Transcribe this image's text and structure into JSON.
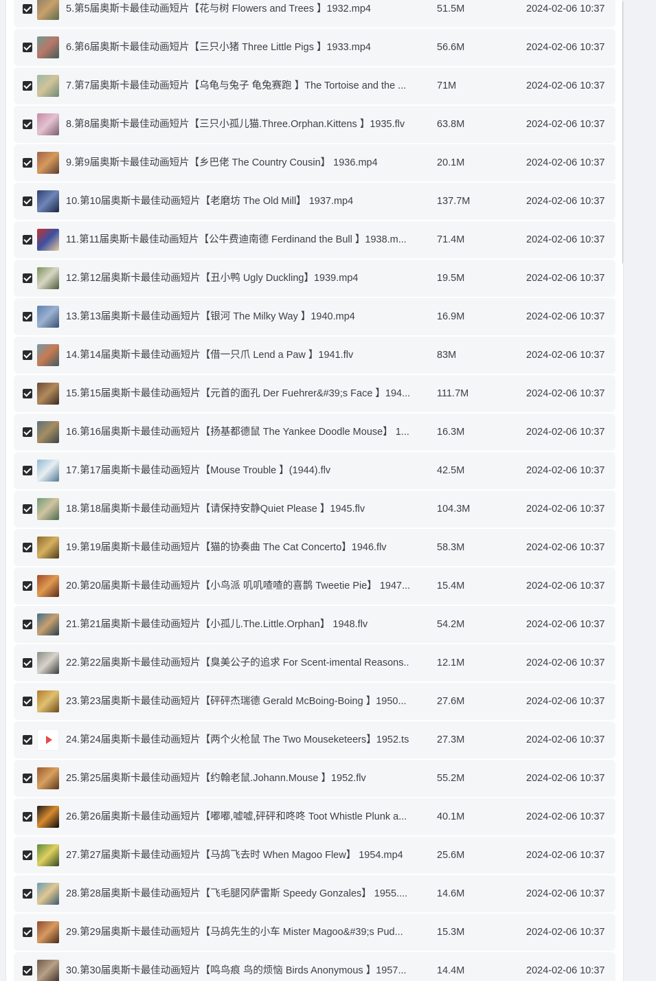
{
  "files": [
    {
      "name": "5.第5届奥斯卡最佳动画短片【花与树 Flowers and Trees 】1932.mp4",
      "size": "51.5M",
      "date": "2024-02-06 10:37",
      "thumb": [
        "#8a7e6b",
        "#c9a06a",
        "#5a6b4e"
      ]
    },
    {
      "name": "6.第6届奥斯卡最佳动画短片【三只小猪 Three Little Pigs 】1933.mp4",
      "size": "56.6M",
      "date": "2024-02-06 10:37",
      "thumb": [
        "#6f9a8c",
        "#b8776a",
        "#3e5f52"
      ]
    },
    {
      "name": "7.第7届奥斯卡最佳动画短片【乌龟与兔子 龟兔赛跑 】The Tortoise and the ...",
      "size": "71M",
      "date": "2024-02-06 10:37",
      "thumb": [
        "#9bb7a3",
        "#d2c49a",
        "#6b8a74"
      ]
    },
    {
      "name": "8.第8届奥斯卡最佳动画短片【三只小孤儿猫.Three.Orphan.Kittens 】1935.flv",
      "size": "63.8M",
      "date": "2024-02-06 10:37",
      "thumb": [
        "#c58aa4",
        "#e4c3d0",
        "#7a5c6e"
      ]
    },
    {
      "name": "9.第9届奥斯卡最佳动画短片【乡巴佬 The Country Cousin】 1936.mp4",
      "size": "20.1M",
      "date": "2024-02-06 10:37",
      "thumb": [
        "#a0604a",
        "#d69a5c",
        "#5a3c30"
      ]
    },
    {
      "name": "10.第10届奥斯卡最佳动画短片【老磨坊 The Old Mill】 1937.mp4",
      "size": "137.7M",
      "date": "2024-02-06 10:37",
      "thumb": [
        "#2e3f6e",
        "#6f86b8",
        "#1a2340"
      ]
    },
    {
      "name": "11.第11届奥斯卡最佳动画短片【公牛费迪南德 Ferdinand the Bull 】1938.m...",
      "size": "71.4M",
      "date": "2024-02-06 10:37",
      "thumb": [
        "#c8322e",
        "#3b4fa0",
        "#e7c9a0"
      ]
    },
    {
      "name": "12.第12届奥斯卡最佳动画短片【丑小鸭 Ugly Duckling】1939.mp4",
      "size": "19.5M",
      "date": "2024-02-06 10:37",
      "thumb": [
        "#7c8f5a",
        "#d8d6c4",
        "#4b5a38"
      ]
    },
    {
      "name": "13.第13届奥斯卡最佳动画短片【银河 The Milky Way 】1940.mp4",
      "size": "16.9M",
      "date": "2024-02-06 10:37",
      "thumb": [
        "#5e7fb0",
        "#9bb2d0",
        "#3a4e70"
      ]
    },
    {
      "name": "14.第14届奥斯卡最佳动画短片【借一只爪 Lend a Paw 】1941.flv",
      "size": "83M",
      "date": "2024-02-06 10:37",
      "thumb": [
        "#6f9aa8",
        "#c87a52",
        "#3e5a60"
      ]
    },
    {
      "name": "15.第15届奥斯卡最佳动画短片【元首的面孔 Der Fuehrer&#39;s Face 】194...",
      "size": "111.7M",
      "date": "2024-02-06 10:37",
      "thumb": [
        "#6b4a34",
        "#b28a5c",
        "#3a2a20"
      ]
    },
    {
      "name": "16.第16届奥斯卡最佳动画短片【扬基都德鼠 The Yankee Doodle Mouse】 1...",
      "size": "16.3M",
      "date": "2024-02-06 10:37",
      "thumb": [
        "#5d6e7a",
        "#a58e62",
        "#39434a"
      ]
    },
    {
      "name": "17.第17届奥斯卡最佳动画短片【Mouse Trouble 】(1944).flv",
      "size": "42.5M",
      "date": "2024-02-06 10:37",
      "thumb": [
        "#8fb8d0",
        "#e8eef2",
        "#4f7890"
      ]
    },
    {
      "name": "18.第18届奥斯卡最佳动画短片【请保持安静Quiet Please 】1945.flv",
      "size": "104.3M",
      "date": "2024-02-06 10:37",
      "thumb": [
        "#6f9a78",
        "#d0c4a0",
        "#4a6a50"
      ]
    },
    {
      "name": "19.第19届奥斯卡最佳动画短片【猫的协奏曲 The Cat Concerto】1946.flv",
      "size": "58.3M",
      "date": "2024-02-06 10:37",
      "thumb": [
        "#8a6a2e",
        "#d6b060",
        "#4e3a18"
      ]
    },
    {
      "name": "20.第20届奥斯卡最佳动画短片【小鸟派 叽叽喳喳的喜鹊 Tweetie Pie】 1947....",
      "size": "15.4M",
      "date": "2024-02-06 10:37",
      "thumb": [
        "#a04a2a",
        "#e09a50",
        "#5a2818"
      ]
    },
    {
      "name": "21.第21届奥斯卡最佳动画短片【小孤儿.The.Little.Orphan】 1948.flv",
      "size": "54.2M",
      "date": "2024-02-06 10:37",
      "thumb": [
        "#3f6e8a",
        "#c8a070",
        "#24404e"
      ]
    },
    {
      "name": "22.第22届奥斯卡最佳动画短片【臭美公子的追求 For Scent-imental Reasons...",
      "size": "12.1M",
      "date": "2024-02-06 10:37",
      "thumb": [
        "#8a8a86",
        "#d8d4cc",
        "#3a3a38"
      ]
    },
    {
      "name": "23.第23届奥斯卡最佳动画短片【砰砰杰瑞德 Gerald McBoing-Boing 】1950...",
      "size": "27.6M",
      "date": "2024-02-06 10:37",
      "thumb": [
        "#b07a2e",
        "#e0c070",
        "#6a4818"
      ]
    },
    {
      "name": "24.第24届奥斯卡最佳动画短片【两个火枪鼠 The Two Mouseketeers】1952.ts",
      "size": "27.3M",
      "date": "2024-02-06 10:37",
      "thumb": "video"
    },
    {
      "name": "25.第25届奥斯卡最佳动画短片【约翰老鼠.Johann.Mouse 】1952.flv",
      "size": "55.2M",
      "date": "2024-02-06 10:37",
      "thumb": [
        "#9a5a2e",
        "#d8a060",
        "#5a3418"
      ]
    },
    {
      "name": "26.第26届奥斯卡最佳动画短片【嘟嘟,嘘嘘,砰砰和咚咚 Toot Whistle Plunk a...",
      "size": "40.1M",
      "date": "2024-02-06 10:37",
      "thumb": [
        "#1a1a1a",
        "#d88a2e",
        "#0a0a0a"
      ]
    },
    {
      "name": "27.第27届奥斯卡最佳动画短片【马鸪飞去时 When Magoo Flew】 1954.mp4",
      "size": "25.6M",
      "date": "2024-02-06 10:37",
      "thumb": [
        "#5a8a3e",
        "#e0d060",
        "#2e4a20"
      ]
    },
    {
      "name": "28.第28届奥斯卡最佳动画短片【飞毛腿冈萨雷斯 Speedy Gonzales】 1955....",
      "size": "14.6M",
      "date": "2024-02-06 10:37",
      "thumb": [
        "#6a9ab8",
        "#e0c890",
        "#3a5a70"
      ]
    },
    {
      "name": "29.第29届奥斯卡最佳动画短片【马鸪先生的小车 Mister Magoo&#39;s Pud...",
      "size": "15.3M",
      "date": "2024-02-06 10:37",
      "thumb": [
        "#8a4a2e",
        "#d89a60",
        "#4a2818"
      ]
    },
    {
      "name": "30.第30届奥斯卡最佳动画短片【鸣鸟痕 鸟的烦恼 Birds Anonymous 】1957...",
      "size": "14.4M",
      "date": "2024-02-06 10:37",
      "thumb": [
        "#6e5a4a",
        "#b8a088",
        "#3e3028"
      ]
    }
  ]
}
